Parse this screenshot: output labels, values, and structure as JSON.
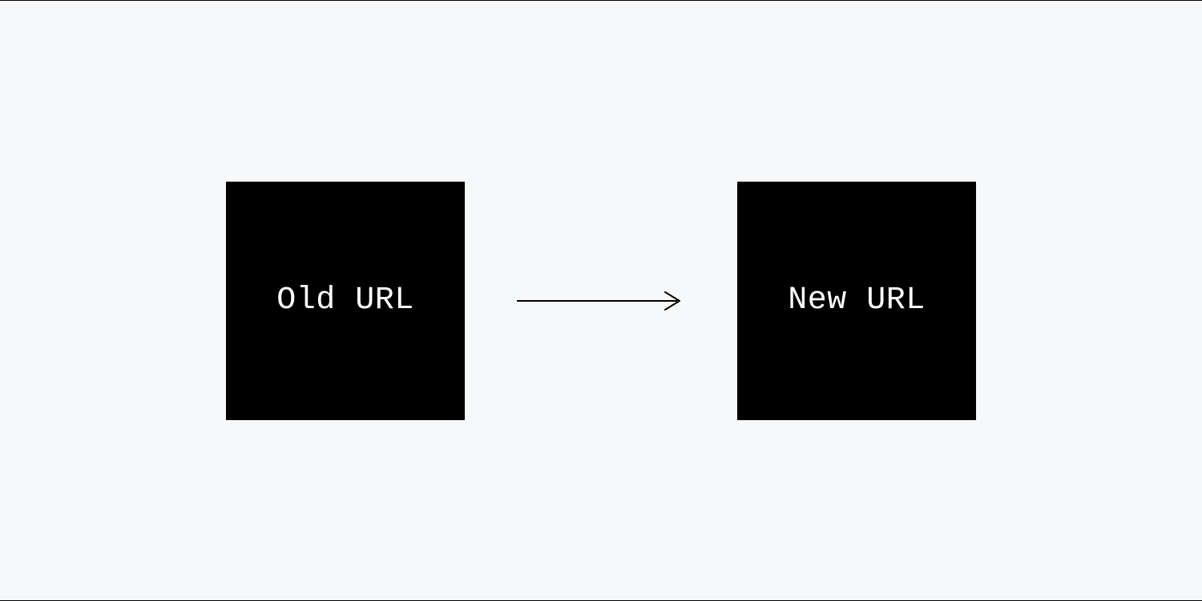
{
  "diagram": {
    "left_box_label": "Old URL",
    "right_box_label": "New URL",
    "relation": "redirects-to"
  },
  "colors": {
    "background": "#f7f8f9",
    "box_bg": "#000000",
    "box_text": "#ffffff",
    "arrow": "#000000",
    "border": "#000000"
  }
}
